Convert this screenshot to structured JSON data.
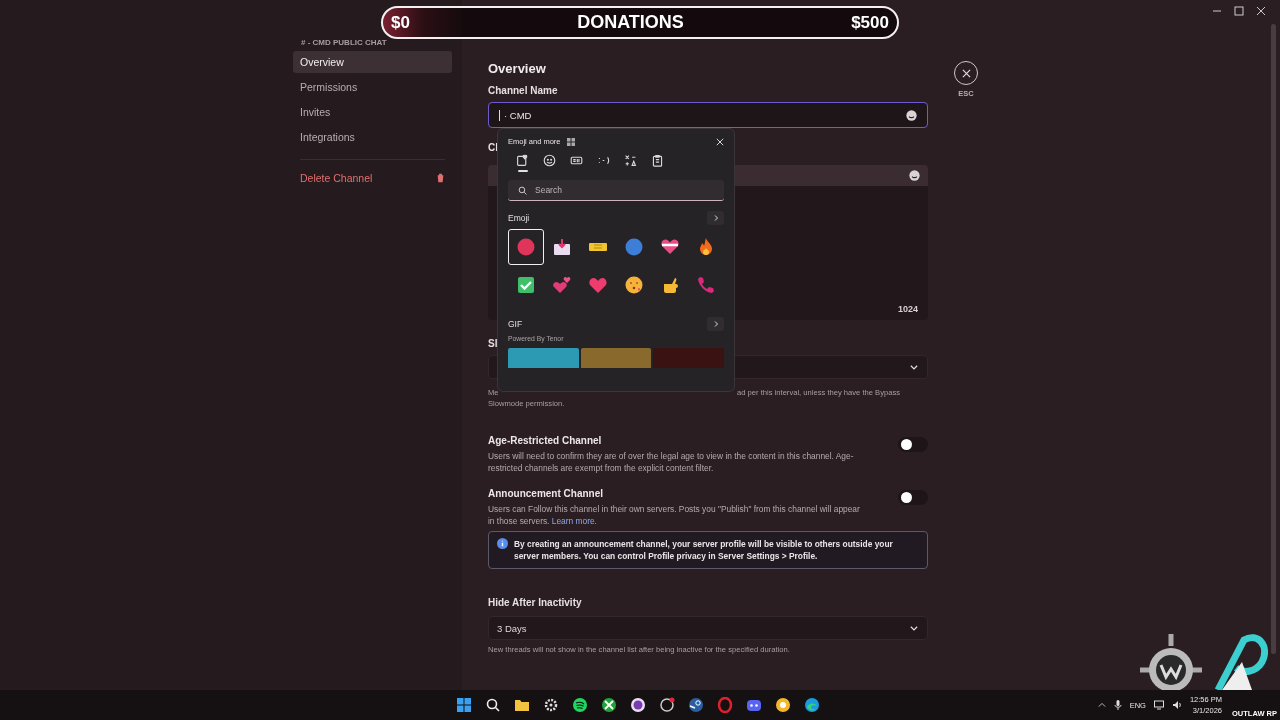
{
  "donations": {
    "min": "$0",
    "title": "DONATIONS",
    "max": "$500"
  },
  "sidebar": {
    "header": "# - CMD PUBLIC CHAT",
    "items": [
      {
        "label": "Overview",
        "selected": true
      },
      {
        "label": "Permissions",
        "selected": false
      },
      {
        "label": "Invites",
        "selected": false
      },
      {
        "label": "Integrations",
        "selected": false
      }
    ],
    "delete": "Delete Channel"
  },
  "close": {
    "label": "ESC"
  },
  "overview": {
    "title": "Overview",
    "name_label": "Channel Name",
    "name_value": "· CMD",
    "topic_label": "Cl",
    "topic_counter": "1024",
    "slowmode_label": "Sl",
    "slowmode_hint_start": "Me",
    "slowmode_hint_end": "ad per this interval, unless they have the Bypass",
    "slowmode_hint_line2": "Slowmode permission.",
    "toggles": [
      {
        "title": "Age-Restricted Channel",
        "description": "Users will need to confirm they are of over the legal age to view in the content in this channel. Age-restricted channels are exempt from the explicit content filter.",
        "on": false
      },
      {
        "title": "Announcement Channel",
        "description": "Users can Follow this channel in their own servers. Posts you \"Publish\" from this channel will appear in those servers.",
        "link": "Learn more.",
        "on": false
      }
    ],
    "notice": "By creating an announcement channel, your server profile will be visible to others outside your server members. You can control Profile privacy in Server Settings > Profile.",
    "hide_label": "Hide After Inactivity",
    "hide_value": "3 Days",
    "hide_hint": "New threads will not show in the channel list after being inactive for the specified duration."
  },
  "emoji_picker": {
    "title": "Emoji and more",
    "tabs": [
      {
        "kind": "favorites",
        "selected": true
      },
      {
        "kind": "emoji",
        "selected": false
      },
      {
        "kind": "gif",
        "selected": false
      },
      {
        "kind": "kaomoji",
        "selected": false
      },
      {
        "kind": "symbols",
        "selected": false
      },
      {
        "kind": "clipboard",
        "selected": false
      }
    ],
    "search": {
      "placeholder": "Search"
    },
    "emoji_section": "Emoji",
    "emoji": [
      {
        "kind": "red-circle",
        "selected": true
      },
      {
        "kind": "inbox",
        "selected": false
      },
      {
        "kind": "ticket",
        "selected": false
      },
      {
        "kind": "blue-circle",
        "selected": false
      },
      {
        "kind": "striped-heart",
        "selected": false
      },
      {
        "kind": "fire",
        "selected": false
      },
      {
        "kind": "check",
        "selected": false
      },
      {
        "kind": "two-hearts",
        "selected": false
      },
      {
        "kind": "heart",
        "selected": false
      },
      {
        "kind": "kiss",
        "selected": false
      },
      {
        "kind": "call-me",
        "selected": false
      },
      {
        "kind": "phone",
        "selected": false
      }
    ],
    "gif_section": "GIF",
    "gif_credit": "Powered By Tenor"
  },
  "taskbar": {
    "apps": [
      {
        "kind": "windows"
      },
      {
        "kind": "search"
      },
      {
        "kind": "folder"
      },
      {
        "kind": "gear"
      },
      {
        "kind": "spotify"
      },
      {
        "kind": "xbox"
      },
      {
        "kind": "purple"
      },
      {
        "kind": "ring"
      },
      {
        "kind": "steam"
      },
      {
        "kind": "opera"
      },
      {
        "kind": "discord"
      },
      {
        "kind": "yellow"
      },
      {
        "kind": "edge"
      }
    ],
    "language": "ENG",
    "time": "12:56 PM",
    "date": "3/1/2026",
    "stream_tag": "OUTLAW RP"
  }
}
